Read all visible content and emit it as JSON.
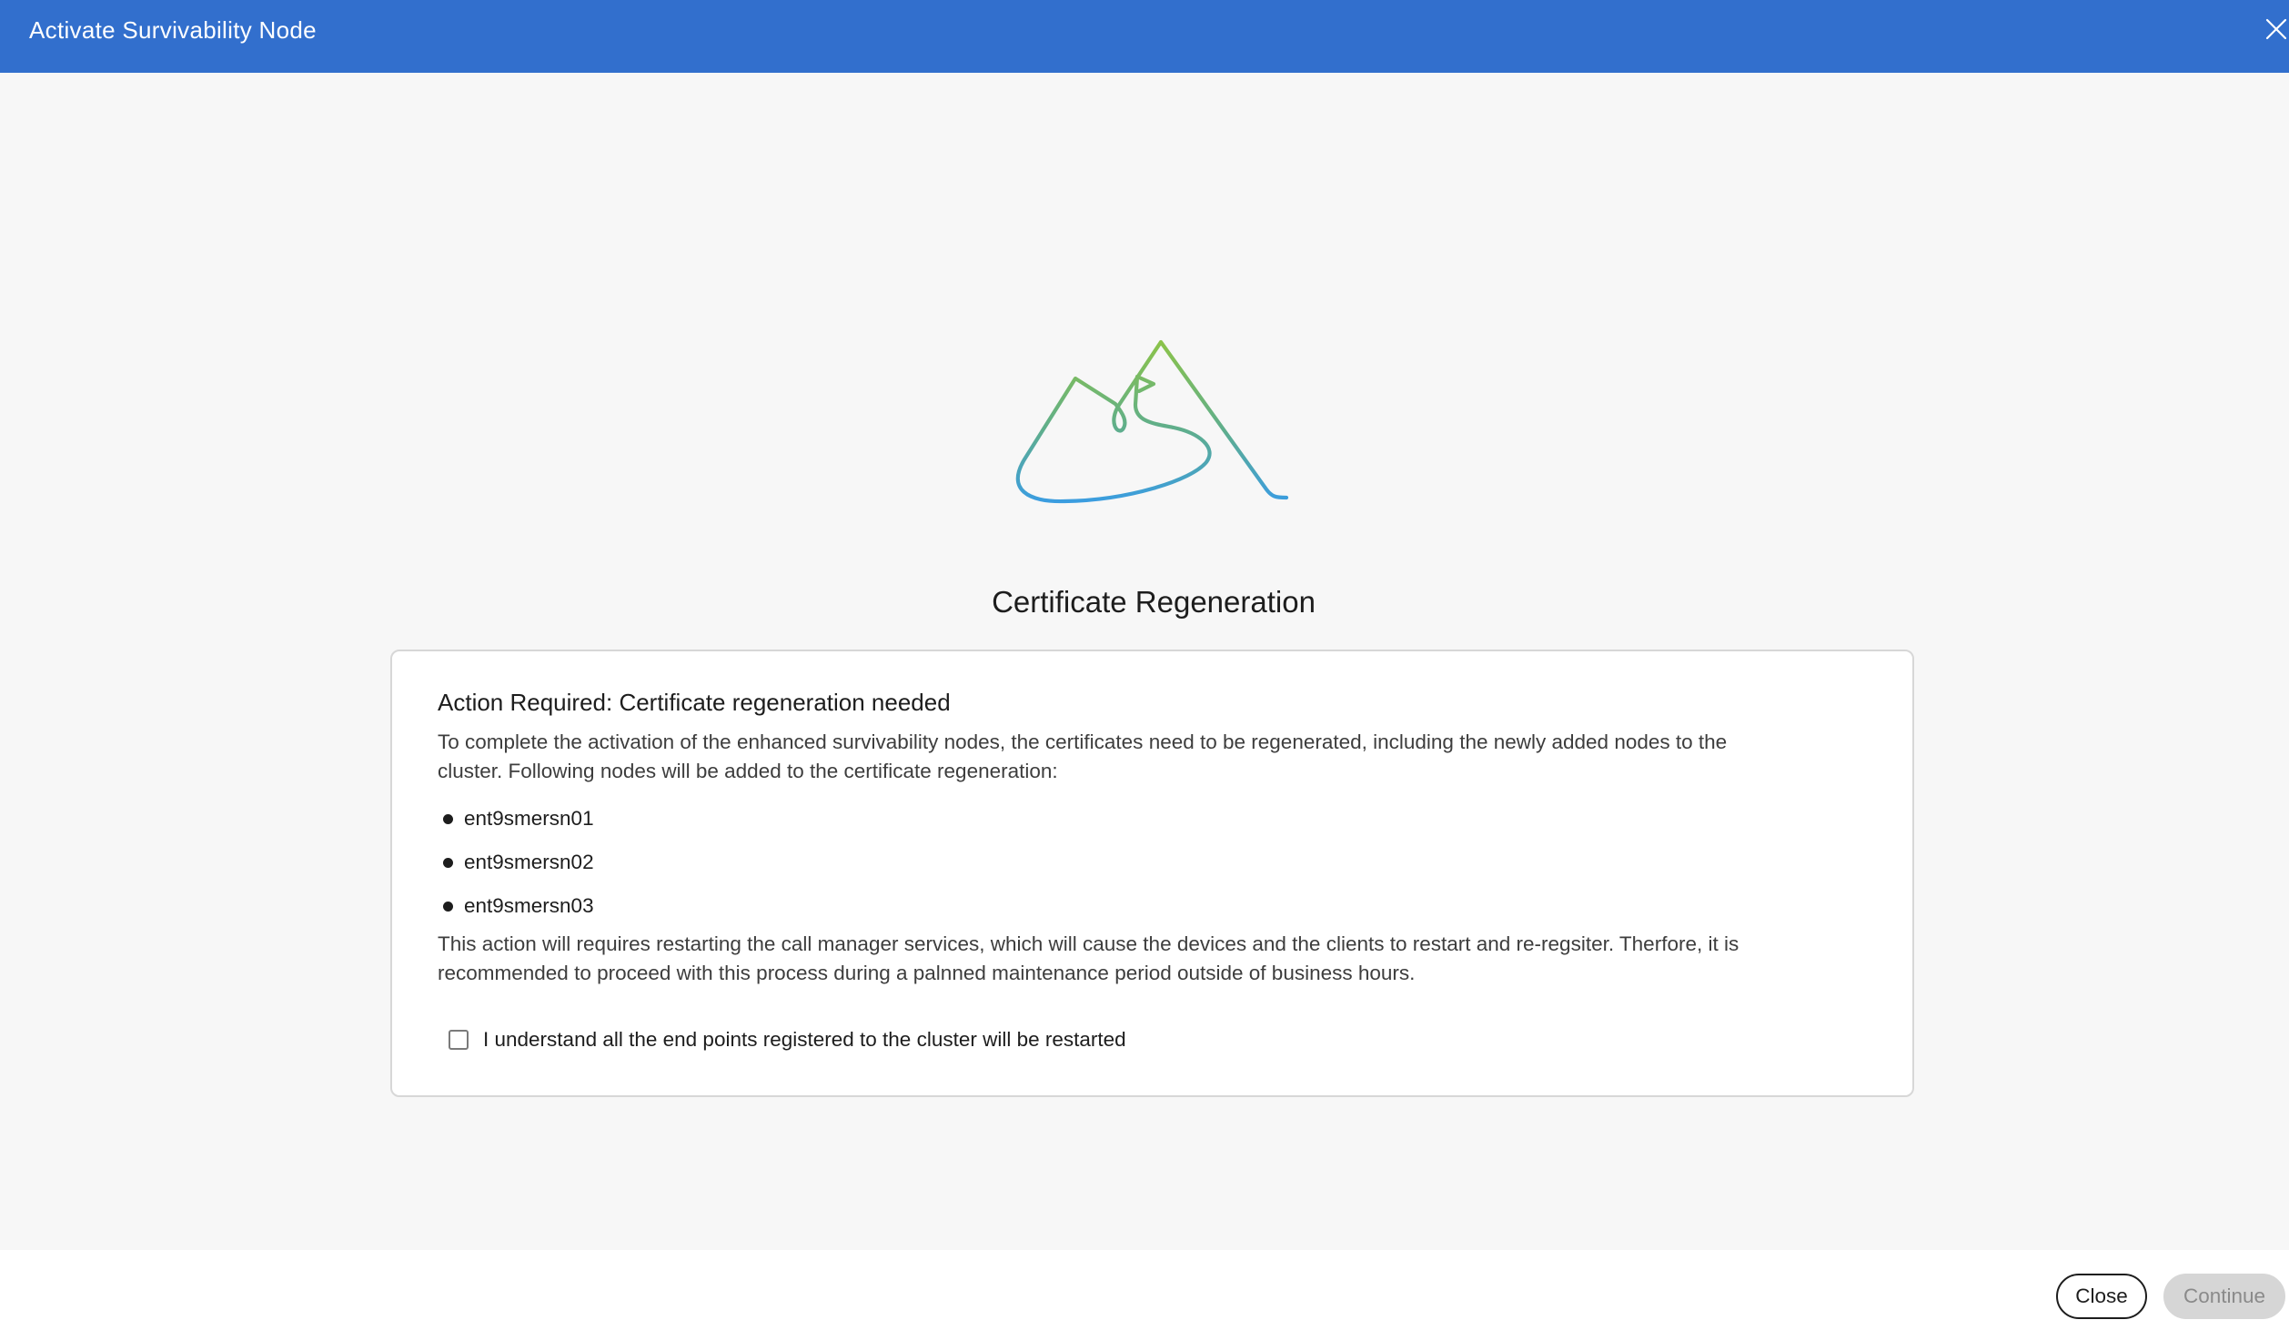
{
  "window": {
    "title": "Activate Survivability Node",
    "close_icon": "close-icon",
    "header_color": "#326fcd"
  },
  "main": {
    "illustration_icon": "mountain-path-illustration",
    "section_title": "Certificate Regeneration",
    "card": {
      "heading": "Action Required: Certificate regeneration needed",
      "description": "To complete the activation of the enhanced survivability nodes, the certificates need to be regenerated, including the newly added nodes to the cluster. Following nodes will be added to the certificate regeneration:",
      "nodes": [
        "ent9smersn01",
        "ent9smersn02",
        "ent9smersn03"
      ],
      "warning": "This action will requires restarting the call manager services, which will cause the devices and the clients to restart and re-regsiter. Therfore, it is recommended to proceed with this process during a palnned maintenance period outside of business hours.",
      "acknowledge_label": "I understand all the end points registered to the cluster will be restarted",
      "acknowledge_checked": false
    }
  },
  "footer": {
    "close_label": "Close",
    "continue_label": "Continue",
    "continue_enabled": false
  }
}
